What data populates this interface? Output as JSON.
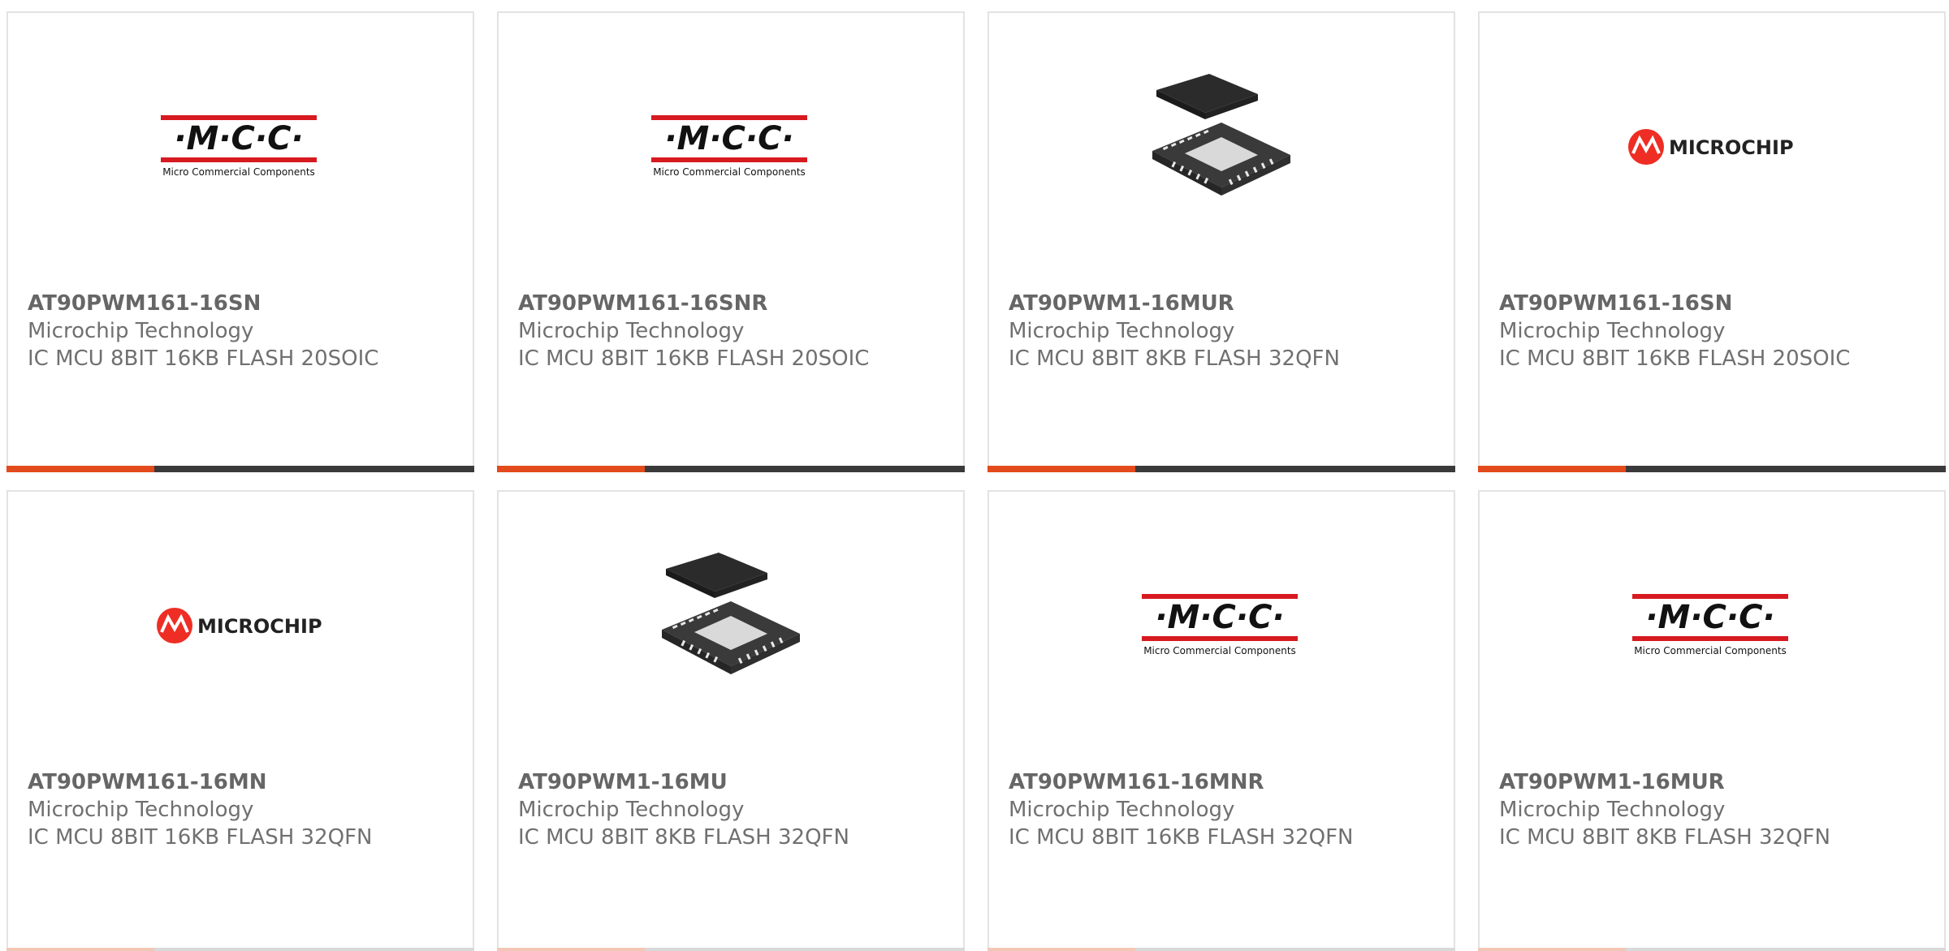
{
  "colors": {
    "accent": "#e34a1c",
    "bar_dark": "#3a3a3a",
    "text": "#707070",
    "card_border": "#e3e3e3",
    "mcc_red": "#d71920",
    "microchip_red": "#ee2e24"
  },
  "products": [
    {
      "part_number": "AT90PWM161-16SN",
      "manufacturer": "Microchip Technology",
      "description": "IC MCU 8BIT 16KB FLASH 20SOIC",
      "image": "mcc-logo"
    },
    {
      "part_number": "AT90PWM161-16SNR",
      "manufacturer": "Microchip Technology",
      "description": "IC MCU 8BIT 16KB FLASH 20SOIC",
      "image": "mcc-logo"
    },
    {
      "part_number": "AT90PWM1-16MUR",
      "manufacturer": "Microchip Technology",
      "description": "IC MCU 8BIT 8KB FLASH 32QFN",
      "image": "qfn-package"
    },
    {
      "part_number": "AT90PWM161-16SN",
      "manufacturer": "Microchip Technology",
      "description": "IC MCU 8BIT 16KB FLASH 20SOIC",
      "image": "microchip-logo"
    },
    {
      "part_number": "AT90PWM161-16MN",
      "manufacturer": "Microchip Technology",
      "description": "IC MCU 8BIT 16KB FLASH 32QFN",
      "image": "microchip-logo"
    },
    {
      "part_number": "AT90PWM1-16MU",
      "manufacturer": "Microchip Technology",
      "description": "IC MCU 8BIT 8KB FLASH 32QFN",
      "image": "qfn-package"
    },
    {
      "part_number": "AT90PWM161-16MNR",
      "manufacturer": "Microchip Technology",
      "description": "IC MCU 8BIT 16KB FLASH 32QFN",
      "image": "mcc-logo"
    },
    {
      "part_number": "AT90PWM1-16MUR",
      "manufacturer": "Microchip Technology",
      "description": "IC MCU 8BIT 8KB FLASH 32QFN",
      "image": "mcc-logo"
    }
  ],
  "logos": {
    "mcc_text": "·M·C·C·",
    "mcc_subtitle": "Micro Commercial Components",
    "microchip_text": "MICROCHIP"
  }
}
